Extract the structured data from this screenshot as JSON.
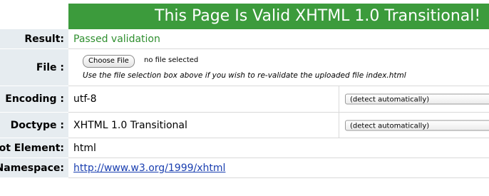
{
  "banner": {
    "title": "This Page Is Valid XHTML 1.0 Transitional!"
  },
  "result": {
    "label": "Result:",
    "value": "Passed validation"
  },
  "file": {
    "label": "File :",
    "choose_button": "Choose File",
    "no_file_text": "no file selected",
    "hint": "Use the file selection box above if you wish to re-validate the uploaded file index.html"
  },
  "encoding": {
    "label": "Encoding :",
    "value": "utf-8",
    "select_value": "(detect automatically)"
  },
  "doctype": {
    "label": "Doctype :",
    "value": "XHTML 1.0 Transitional",
    "select_value": "(detect automatically)"
  },
  "root_element": {
    "label": "Root Element:",
    "value": "html"
  },
  "namespace": {
    "label": "Root Namespace:",
    "value": "http://www.w3.org/1999/xhtml"
  }
}
